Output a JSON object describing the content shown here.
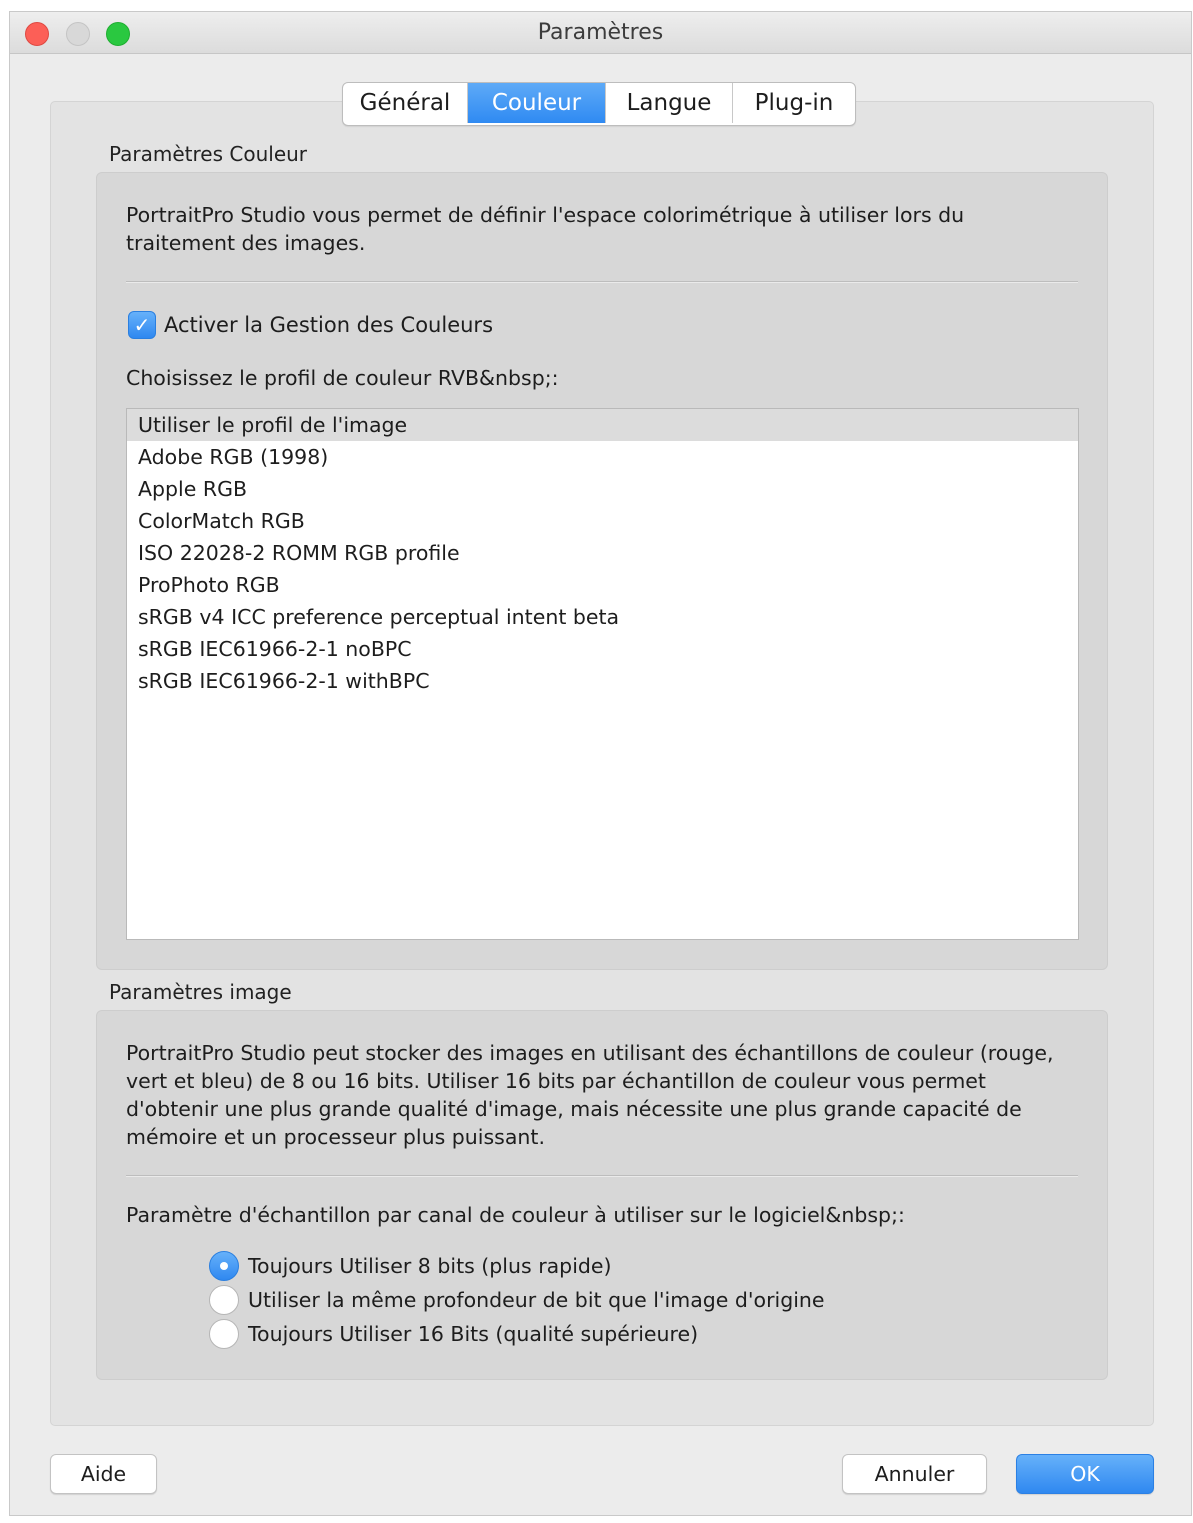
{
  "window": {
    "title": "Paramètres"
  },
  "tabs": [
    {
      "label": "Général",
      "active": false
    },
    {
      "label": "Couleur",
      "active": true
    },
    {
      "label": "Langue",
      "active": false
    },
    {
      "label": "Plug-in",
      "active": false
    }
  ],
  "color_settings": {
    "group_label": "Paramètres Couleur",
    "description": "PortraitPro Studio vous permet de définir l'espace colorimétrique à utiliser lors du traitement des images.",
    "enable_color_management": {
      "label": "Activer la Gestion des Couleurs",
      "checked": true
    },
    "profile_prompt": "Choisissez le profil de couleur RVB&nbsp;:",
    "profiles": [
      "Utiliser le profil de l'image",
      "Adobe RGB (1998)",
      "Apple RGB",
      "ColorMatch RGB",
      "ISO 22028-2 ROMM RGB profile",
      "ProPhoto RGB",
      "sRGB v4 ICC preference perceptual intent beta",
      "sRGB IEC61966-2-1 noBPC",
      "sRGB IEC61966-2-1 withBPC"
    ],
    "selected_profile": "Utiliser le profil de l'image"
  },
  "image_settings": {
    "group_label": "Paramètres image",
    "description": "PortraitPro Studio peut stocker des images en utilisant des échantillons de couleur (rouge, vert et bleu) de 8 ou 16 bits.  Utiliser 16 bits par échantillon de couleur vous permet d'obtenir une plus grande qualité d'image, mais nécessite une plus grande capacité de mémoire et un processeur plus puissant.",
    "bit_depth_prompt": "Paramètre d'échantillon par canal de couleur à utiliser sur le logiciel&nbsp;:",
    "options": [
      {
        "label": "Toujours Utiliser 8 bits (plus rapide)",
        "checked": true
      },
      {
        "label": "Utiliser la même profondeur de bit que l'image d'origine",
        "checked": false
      },
      {
        "label": "Toujours Utiliser 16 Bits (qualité supérieure)",
        "checked": false
      }
    ]
  },
  "buttons": {
    "help": "Aide",
    "cancel": "Annuler",
    "ok": "OK"
  },
  "colors": {
    "accent": "#2f88f0",
    "window_bg": "#ececec",
    "group_bg": "#d7d7d7"
  }
}
